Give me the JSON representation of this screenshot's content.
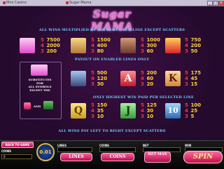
{
  "window": {
    "tabs": [
      {
        "label": "Mini Casino"
      },
      {
        "label": "Sugar Mama"
      }
    ],
    "controls": [
      "_",
      "□",
      "×"
    ]
  },
  "game": {
    "title": "Sugar MAMA",
    "headers": {
      "top": "ALL WINS MULTIPLIED BY COINS BET PER LINE EXCEPT SCATTERS",
      "mid": "PAYOUT ON ENABLED LINES ONLY",
      "low": "ONLY HIGHEST WIN PAID PER SELECTED LINE",
      "bottom": "ALL WINS PAY LEFT TO RIGHT EXCEPT SCATTERS"
    },
    "paytable_row1": [
      {
        "symbol": "sugar-mama-logo",
        "pays": [
          [
            "5",
            "7500"
          ],
          [
            "4",
            "2000"
          ],
          [
            "3",
            "200"
          ]
        ]
      },
      {
        "symbol": "blonde-lady",
        "pays": [
          [
            "5",
            "1500"
          ],
          [
            "4",
            "400"
          ],
          [
            "3",
            "80"
          ]
        ]
      },
      {
        "symbol": "dog",
        "pays": [
          [
            "5",
            "1000"
          ],
          [
            "4",
            "300"
          ],
          [
            "3",
            "60"
          ]
        ]
      },
      {
        "symbol": "car",
        "pays": [
          [
            "5",
            "750"
          ],
          [
            "4",
            "200"
          ],
          [
            "3",
            "50"
          ]
        ]
      }
    ],
    "wild_note": {
      "lines": [
        "SUBSTITUTES",
        "FOR",
        "ALL SYMBOLS",
        "EXCEPT THE"
      ],
      "and": "AND"
    },
    "paytable_row2": [
      {
        "symbol": "man",
        "pays": [
          [
            "5",
            "500"
          ],
          [
            "4",
            "120"
          ],
          [
            "3",
            "30"
          ]
        ]
      },
      {
        "symbol": "card-a",
        "glyph": "A",
        "pays": [
          [
            "5",
            "200"
          ],
          [
            "4",
            "60"
          ],
          [
            "3",
            "20"
          ]
        ]
      },
      {
        "symbol": "card-k",
        "glyph": "K",
        "pays": [
          [
            "5",
            "175"
          ],
          [
            "4",
            "45"
          ],
          [
            "3",
            "15"
          ]
        ]
      }
    ],
    "paytable_row3": [
      {
        "symbol": "card-q",
        "glyph": "Q",
        "pays": [
          [
            "5",
            "150"
          ],
          [
            "4",
            "35"
          ],
          [
            "3",
            "10"
          ]
        ]
      },
      {
        "symbol": "card-j",
        "glyph": "J",
        "pays": [
          [
            "5",
            "125"
          ],
          [
            "4",
            "30"
          ],
          [
            "3",
            "10"
          ]
        ]
      },
      {
        "symbol": "card-10",
        "glyph": "10",
        "pays": [
          [
            "5",
            "100"
          ],
          [
            "4",
            "25"
          ],
          [
            "3",
            "5"
          ]
        ]
      }
    ]
  },
  "panel": {
    "back_label": "BACK TO GAME",
    "coins_label": "COINS",
    "coins_value": "0",
    "coin_value": "0.01",
    "lines_label": "LINES",
    "lines_btn": "LINES",
    "coins_field_label": "COINS",
    "coins_btn": "COINS",
    "bet_label": "BET",
    "betmax_btn": "BET MAX",
    "win_label": "WIN",
    "spin_btn": "SPIN"
  },
  "colors": {
    "accent": "#6fd3ff",
    "payout_value": "#ffd23a",
    "payout_count": "#e83b3b",
    "spin": "#e6346f"
  }
}
